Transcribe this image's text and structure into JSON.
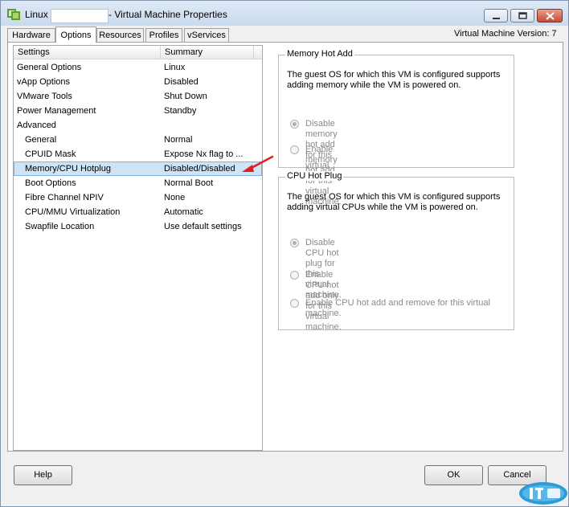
{
  "window": {
    "title_prefix": "Linux",
    "title_suffix": "- Virtual Machine Properties"
  },
  "tabs": [
    {
      "label": "Hardware"
    },
    {
      "label": "Options"
    },
    {
      "label": "Resources"
    },
    {
      "label": "Profiles"
    },
    {
      "label": "vServices"
    }
  ],
  "version_text": "Virtual Machine Version: 7",
  "settings_list": {
    "headers": [
      "Settings",
      "Summary"
    ],
    "rows": [
      {
        "setting": "General Options",
        "summary": "Linux"
      },
      {
        "setting": "vApp Options",
        "summary": "Disabled"
      },
      {
        "setting": "VMware Tools",
        "summary": "Shut Down"
      },
      {
        "setting": "Power Management",
        "summary": "Standby"
      },
      {
        "setting": "Advanced",
        "summary": ""
      },
      {
        "setting": "General",
        "summary": "Normal"
      },
      {
        "setting": "CPUID Mask",
        "summary": "Expose Nx flag to ..."
      },
      {
        "setting": "Memory/CPU Hotplug",
        "summary": "Disabled/Disabled"
      },
      {
        "setting": "Boot Options",
        "summary": "Normal Boot"
      },
      {
        "setting": "Fibre Channel NPIV",
        "summary": "None"
      },
      {
        "setting": "CPU/MMU Virtualization",
        "summary": "Automatic"
      },
      {
        "setting": "Swapfile Location",
        "summary": "Use default settings"
      }
    ]
  },
  "memory_hot_add": {
    "title": "Memory Hot Add",
    "description": "The guest OS for which this VM is configured supports adding memory while the VM is powered on.",
    "options": [
      {
        "label": "Disable memory hot add for this virtual machine.",
        "selected": true
      },
      {
        "label": "Enable memory hot add for this virtual machine.",
        "selected": false
      }
    ]
  },
  "cpu_hot_plug": {
    "title": "CPU Hot Plug",
    "description": "The guest OS for which this VM is configured supports adding virtual CPUs while the VM is powered on.",
    "options": [
      {
        "label": "Disable CPU hot plug for this virtual machine.",
        "selected": true
      },
      {
        "label": "Enable CPU hot add only for this virtual machine.",
        "selected": false
      },
      {
        "label": "Enable CPU hot add and remove for this virtual machine.",
        "selected": false
      }
    ]
  },
  "buttons": {
    "help": "Help",
    "ok": "OK",
    "cancel": "Cancel"
  },
  "colors": {
    "selection_bg": "#cde3f6",
    "titlebar": "#c9daee",
    "close_button": "#c64b32",
    "annotation_arrow": "#e02020"
  },
  "icons": [
    "vm-properties-icon",
    "minimize-icon",
    "maximize-icon",
    "close-icon",
    "annotation-arrow-icon"
  ]
}
